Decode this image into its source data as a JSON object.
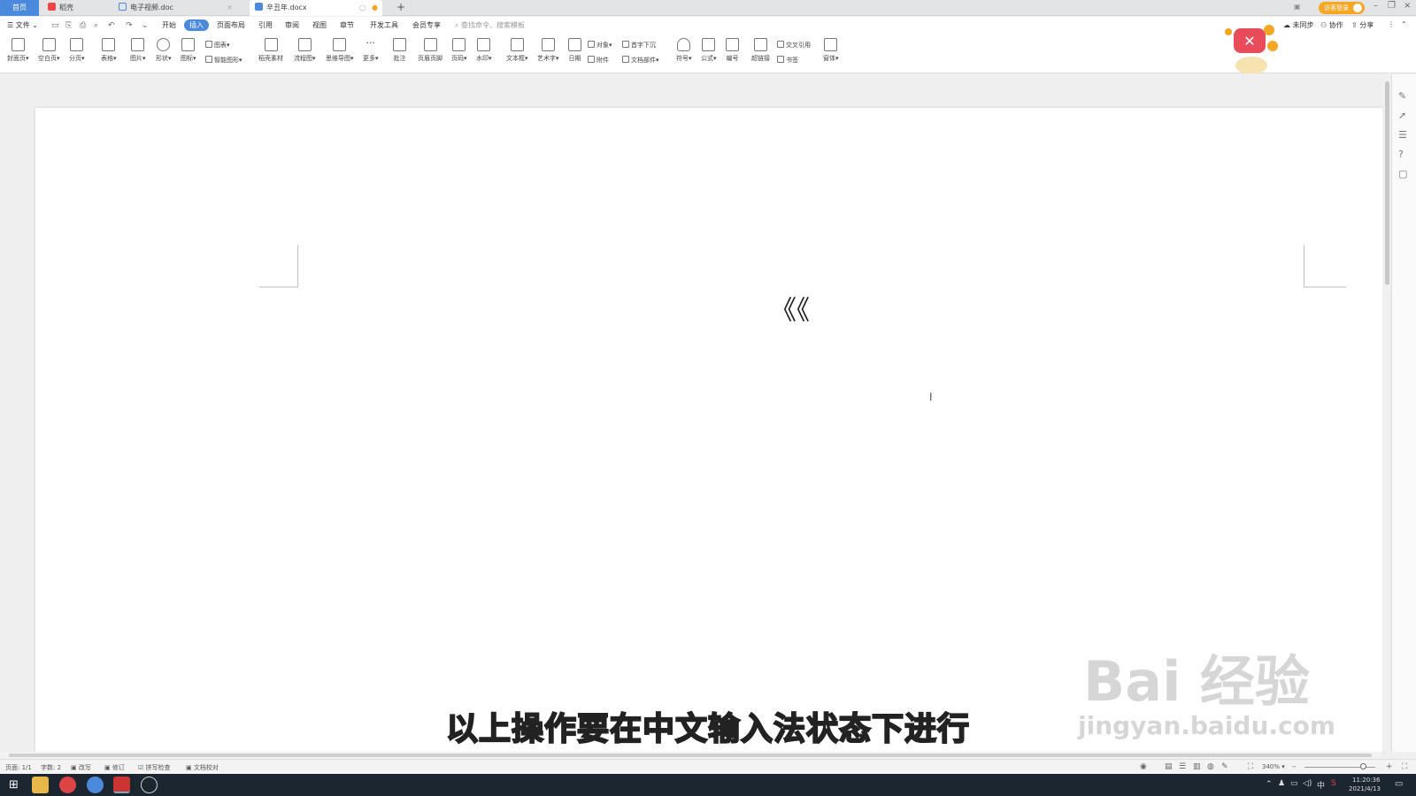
{
  "tabs": {
    "home": "首页",
    "t1": "稻壳",
    "t2": "电子视频.doc",
    "t3": "辛丑年.docx",
    "new_tab": "+"
  },
  "title_right": {
    "login": "访客登录"
  },
  "menu": {
    "file": "文件",
    "items": [
      "开始",
      "插入",
      "页面布局",
      "引用",
      "审阅",
      "视图",
      "章节",
      "开发工具",
      "会员专享"
    ],
    "search_placeholder": "查找命令、搜索模板",
    "right": [
      "未同步",
      "协作",
      "分享"
    ]
  },
  "ribbon": {
    "cover": "封面页",
    "blank": "空白页",
    "pagebreak": "分页",
    "table": "表格",
    "picture": "图片",
    "shape": "形状",
    "icons": "图标",
    "chart": "图表",
    "smartart": "智能图形",
    "docshell": "稻壳素材",
    "flow": "流程图",
    "mind": "思维导图",
    "more": "更多",
    "comment": "批注",
    "header": "页眉页脚",
    "pagenum": "页码",
    "watermark": "水印",
    "textbox": "文本框",
    "art": "艺术字",
    "date": "日期",
    "object": "对象",
    "attach": "附件",
    "dropcap": "首字下沉",
    "docpart": "文档部件",
    "symbol": "符号",
    "formula": "公式",
    "numbering": "编号",
    "hyperlink": "超链接",
    "crossref": "交叉引用",
    "bookmark": "书签",
    "window": "窗体"
  },
  "document": {
    "text": "《《",
    "cursor": "I"
  },
  "subtitle": "以上操作要在中文输入法状态下进行",
  "watermark": {
    "main": "Bai 经验",
    "sub": "jingyan.baidu.com"
  },
  "status": {
    "page": "页面: 1/1",
    "words": "字数: 2",
    "rewrite": "改写",
    "revise": "修订",
    "spell": "拼写检查",
    "proof": "文档校对",
    "zoom": "340%"
  },
  "taskbar": {
    "ime": "中",
    "time": "11:20:36",
    "date": "2021/4/13"
  },
  "colors": {
    "accent": "#4a89dc",
    "login": "#f5a623",
    "taskbar": "#1c2631"
  }
}
